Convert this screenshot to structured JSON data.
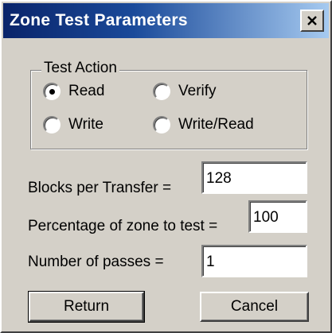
{
  "window": {
    "title": "Zone Test Parameters"
  },
  "test_action": {
    "label": "Test Action",
    "options": [
      {
        "label": "Read",
        "selected": true
      },
      {
        "label": "Verify",
        "selected": false
      },
      {
        "label": "Write",
        "selected": false
      },
      {
        "label": "Write/Read",
        "selected": false
      }
    ]
  },
  "fields": {
    "blocks_per_transfer": {
      "label": "Blocks per Transfer =",
      "value": "128"
    },
    "percentage_of_zone": {
      "label": "Percentage of zone to test =",
      "value": "100"
    },
    "number_of_passes": {
      "label": "Number of passes =",
      "value": "1"
    }
  },
  "buttons": {
    "return_label": "Return",
    "cancel_label": "Cancel"
  },
  "icons": {
    "close": "close-icon"
  },
  "colors": {
    "title_gradient_start": "#0a246a",
    "title_gradient_end": "#a6caf0",
    "face": "#d4d0c8"
  }
}
